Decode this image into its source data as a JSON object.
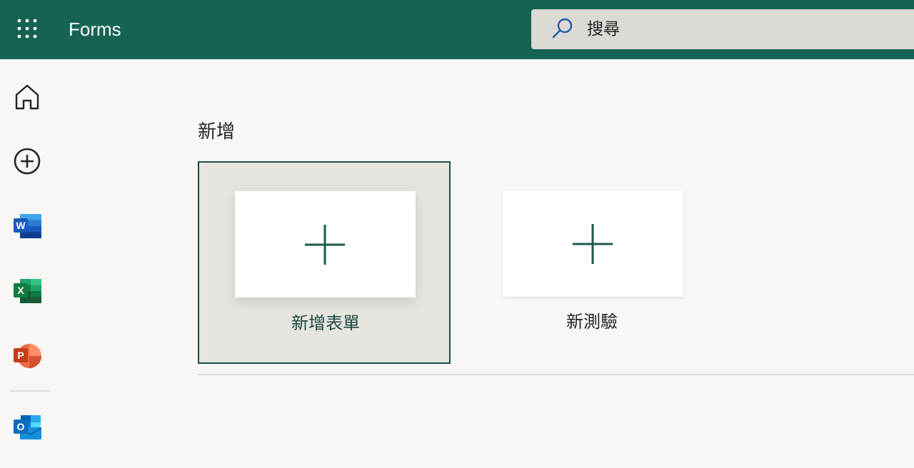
{
  "header": {
    "app_title": "Forms",
    "search_placeholder": "搜尋"
  },
  "sidebar": {
    "items": [
      {
        "name": "home",
        "icon": "home-icon"
      },
      {
        "name": "create",
        "icon": "add-circle-icon"
      },
      {
        "name": "word",
        "icon": "word-icon",
        "letter": "W"
      },
      {
        "name": "excel",
        "icon": "excel-icon",
        "letter": "X"
      },
      {
        "name": "powerpoint",
        "icon": "powerpoint-icon",
        "letter": "P"
      },
      {
        "name": "outlook",
        "icon": "outlook-icon",
        "letter": "O"
      }
    ]
  },
  "main": {
    "section_heading": "新增",
    "tiles": [
      {
        "label": "新增表單",
        "selected": true
      },
      {
        "label": "新測驗",
        "selected": false
      }
    ]
  },
  "colors": {
    "brand": "#166354",
    "search_bg": "#dcd8d4",
    "page_bg": "#f8f7f5",
    "accent_dark": "#1d4f45"
  }
}
